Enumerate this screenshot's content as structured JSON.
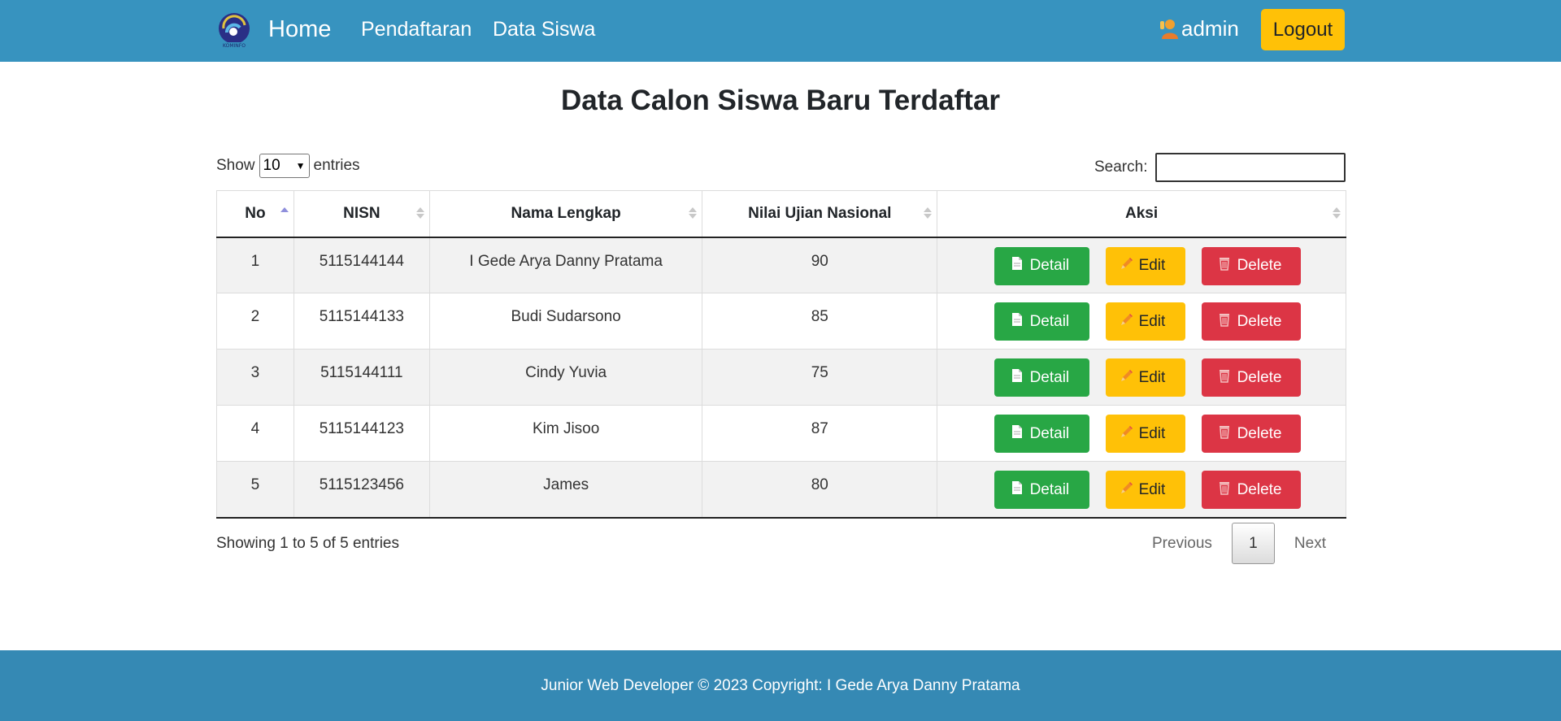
{
  "navbar": {
    "brand": "Home",
    "links": [
      "Pendaftaran",
      "Data Siswa"
    ],
    "user": "admin",
    "logout": "Logout",
    "bg_color": "#3793bf"
  },
  "page": {
    "title": "Data Calon Siswa Baru Terdaftar"
  },
  "controls": {
    "show_label": "Show",
    "entries_value": "10",
    "entries_label": "entries",
    "search_label": "Search:"
  },
  "table": {
    "headers": [
      "No",
      "NISN",
      "Nama Lengkap",
      "Nilai Ujian Nasional",
      "Aksi"
    ],
    "rows": [
      {
        "no": "1",
        "nisn": "5115144144",
        "nama": "I Gede Arya Danny Pratama",
        "nilai": "90"
      },
      {
        "no": "2",
        "nisn": "5115144133",
        "nama": "Budi Sudarsono",
        "nilai": "85"
      },
      {
        "no": "3",
        "nisn": "5115144111",
        "nama": "Cindy Yuvia",
        "nilai": "75"
      },
      {
        "no": "4",
        "nisn": "5115144123",
        "nama": "Kim Jisoo",
        "nilai": "87"
      },
      {
        "no": "5",
        "nisn": "5115123456",
        "nama": "James",
        "nilai": "80"
      }
    ],
    "actions": {
      "detail": "Detail",
      "edit": "Edit",
      "delete": "Delete"
    }
  },
  "pagination": {
    "info": "Showing 1 to 5 of 5 entries",
    "previous": "Previous",
    "current": "1",
    "next": "Next"
  },
  "footer": {
    "text": "Junior Web Developer © 2023 Copyright: I Gede Arya Danny Pratama"
  },
  "colors": {
    "detail": "#28a745",
    "edit": "#ffc107",
    "delete": "#dc3545",
    "footer": "#3589b4"
  }
}
